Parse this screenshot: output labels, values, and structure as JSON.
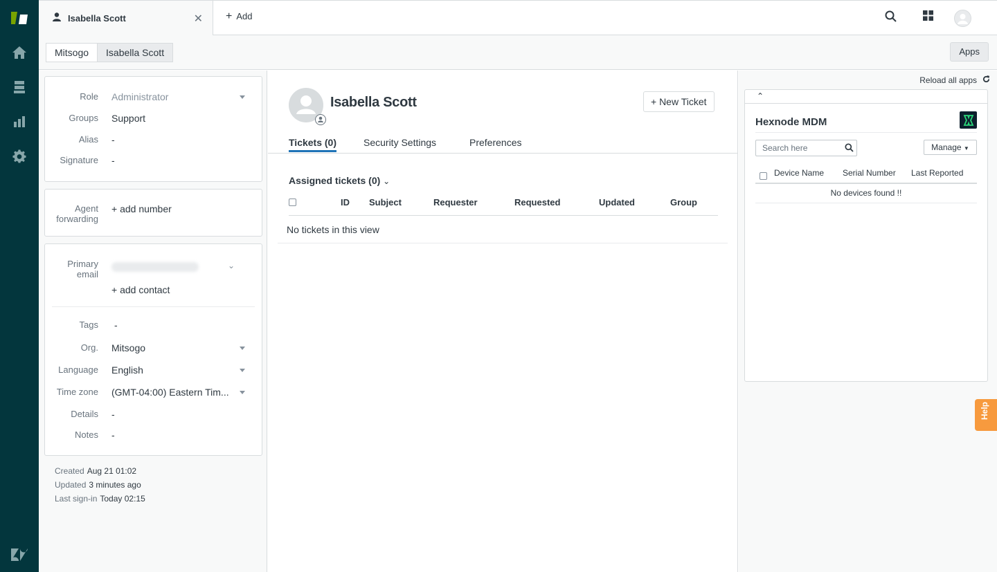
{
  "tabs": {
    "active_label": "Isabella Scott",
    "add_label": "Add"
  },
  "breadcrumb": [
    "Mitsogo",
    "Isabella Scott"
  ],
  "apps_button": "Apps",
  "user_fields": {
    "role": {
      "label": "Role",
      "value": "Administrator"
    },
    "groups": {
      "label": "Groups",
      "value": "Support"
    },
    "alias": {
      "label": "Alias",
      "value": "-"
    },
    "signature": {
      "label": "Signature",
      "value": "-"
    },
    "agent_forwarding": {
      "label_line1": "Agent",
      "label_line2": "forwarding",
      "value": "+ add number"
    },
    "primary_email": {
      "label_line1": "Primary",
      "label_line2": "email",
      "value": ""
    },
    "add_contact": "+ add contact",
    "tags": {
      "label": "Tags",
      "value": "-"
    },
    "org": {
      "label": "Org.",
      "value": "Mitsogo"
    },
    "language": {
      "label": "Language",
      "value": "English"
    },
    "time_zone": {
      "label": "Time zone",
      "value": "(GMT-04:00) Eastern Tim..."
    },
    "details": {
      "label": "Details",
      "value": "-"
    },
    "notes": {
      "label": "Notes",
      "value": "-"
    }
  },
  "meta": {
    "created_label": "Created",
    "created_value": "Aug 21 01:02",
    "updated_label": "Updated",
    "updated_value": "3 minutes ago",
    "last_signin_label": "Last sign-in",
    "last_signin_value": "Today 02:15"
  },
  "profile": {
    "name": "Isabella Scott",
    "new_ticket": "+ New Ticket"
  },
  "profile_tabs": [
    "Tickets (0)",
    "Security Settings",
    "Preferences"
  ],
  "tickets": {
    "view_title": "Assigned tickets (0)",
    "columns": [
      "ID",
      "Subject",
      "Requester",
      "Requested",
      "Updated",
      "Group"
    ],
    "empty": "No tickets in this view"
  },
  "apps_panel": {
    "reload": "Reload all apps",
    "app_name": "Hexnode MDM",
    "search_placeholder": "Search here",
    "manage": "Manage",
    "columns": [
      "Device Name",
      "Serial Number",
      "Last Reported"
    ],
    "empty": "No devices found !!"
  },
  "help": "Help",
  "colors": {
    "rail": "#03363d",
    "accent": "#1f73b7",
    "zendesk_green": "#78a300",
    "help_orange": "#f79a3e"
  }
}
